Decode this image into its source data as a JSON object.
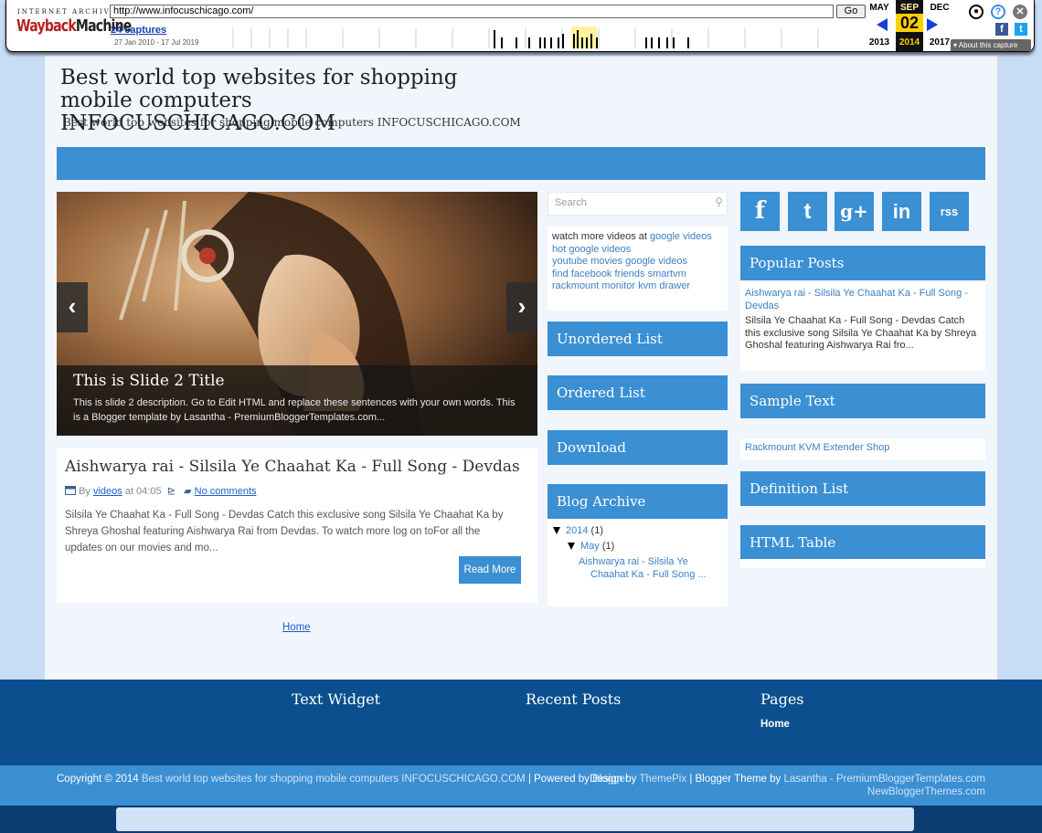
{
  "wayback": {
    "logo_top": "INTERNET ARCHIVE",
    "logo_main_1": "Wayback",
    "logo_main_2": "Machine",
    "url": "http://www.infocuschicago.com/",
    "go_label": "Go",
    "captures": "24 captures",
    "capture_range": "27 Jan 2010 - 17 Jul 2019",
    "prev_month": "MAY",
    "cur_month": "SEP",
    "cur_day": "02",
    "next_month": "DEC",
    "prev_year": "2013",
    "cur_year": "2014",
    "next_year": "2017",
    "about_label": "About this capture",
    "icons": [
      "user-icon",
      "help-icon",
      "close-icon",
      "facebook-icon",
      "twitter-icon"
    ]
  },
  "site": {
    "title": "Best world top websites for shopping mobile computers INFOCUSCHICAGO.COM",
    "description": "Best world top websites for shopping mobile computers INFOCUSCHICAGO.COM"
  },
  "slider": {
    "prev_glyph": "‹",
    "next_glyph": "›",
    "title": "This is Slide 2 Title",
    "description": "This is slide 2 description. Go to Edit HTML and replace these sentences with your own words. This is a Blogger template by Lasantha - PremiumBloggerTemplates.com..."
  },
  "post": {
    "title": "Aishwarya rai - Silsila Ye Chaahat Ka - Full Song - Devdas",
    "by_label": "By",
    "author": "videos",
    "at_label": "at 04:05",
    "comments": "No comments",
    "excerpt": "Silsila Ye Chaahat Ka - Full Song - Devdas Catch this exclusive song Silsila Ye Chaahat Ka by Shreya Ghoshal featuring Aishwarya Rai from Devdas. To watch more log on toFor all the updates on our movies and mo...",
    "read_more": "Read More"
  },
  "home_link": "Home",
  "sidebar_mid": {
    "search_placeholder": "Search",
    "links": {
      "prefix": "watch more videos at ",
      "l1": "google videos",
      "l2": "hot google videos",
      "l3": "youtube movies google videos",
      "l4": "find facebook friends smartvm",
      "l5": "rackmount monitor kvm drawer"
    },
    "widgets": [
      "Unordered List",
      "Ordered List",
      "Download",
      "Blog Archive"
    ],
    "archive": {
      "year": "2014",
      "year_count": "(1)",
      "month": "May",
      "month_count": "(1)",
      "post_line1": "Aishwarya rai - Silsila Ye",
      "post_line2": "Chaahat Ka - Full Song ..."
    }
  },
  "sidebar_right": {
    "social_icons": [
      "f",
      "t",
      "g+",
      "in",
      "rss"
    ],
    "widgets": [
      "Popular Posts",
      "Sample Text",
      "Definition List",
      "HTML Table"
    ],
    "popular_title": "Aishwarya rai - Silsila Ye Chaahat Ka - Full Song - Devdas",
    "popular_desc": "Silsila Ye Chaahat Ka - Full Song - Devdas Catch this exclusive song Silsila Ye Chaahat Ka by Shreya Ghoshal featuring Aishwarya Rai fro...",
    "sample_text": "Rackmount KVM Extender Shop"
  },
  "footer": {
    "widgets": [
      "Text Widget",
      "Recent Posts",
      "Pages"
    ],
    "pages_home": "Home",
    "copyright_prefix": "Copyright © 2014 ",
    "copyright_site": "Best world top websites for shopping mobile computers INFOCUSCHICAGO.COM",
    "powered_by": " | Powered by ",
    "blogger": "Blogger",
    "design_by": "Design by ",
    "themepix": "ThemePix",
    "blogger_theme_by": " | Blogger Theme by ",
    "lasantha": "Lasantha - PremiumBloggerTemplates.com",
    "nbt": "NewBloggerThemes.com"
  },
  "colors": {
    "accent": "#3b8fd3",
    "footer": "#0b4f8e",
    "page_bg": "#f1f6fd",
    "link": "#3b7fc4"
  }
}
